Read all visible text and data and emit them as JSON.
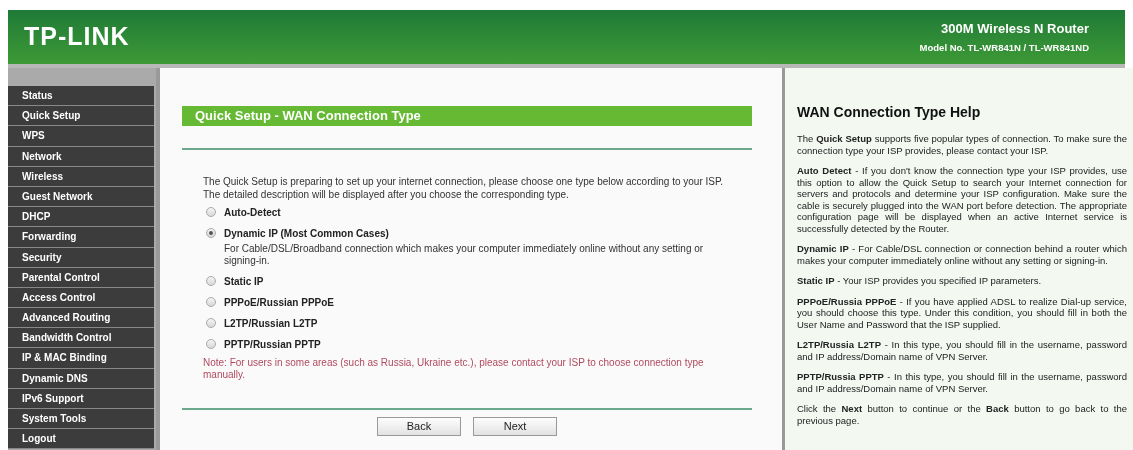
{
  "header": {
    "logo": "TP-LINK",
    "product": "300M Wireless N Router",
    "model": "Model No. TL-WR841N / TL-WR841ND"
  },
  "sidebar": {
    "items": [
      "Status",
      "Quick Setup",
      "WPS",
      "Network",
      "Wireless",
      "Guest Network",
      "DHCP",
      "Forwarding",
      "Security",
      "Parental Control",
      "Access Control",
      "Advanced Routing",
      "Bandwidth Control",
      "IP & MAC Binding",
      "Dynamic DNS",
      "IPv6 Support",
      "System Tools",
      "Logout"
    ]
  },
  "main": {
    "title": "Quick Setup - WAN Connection Type",
    "intro": [
      "The Quick Setup is preparing to set up your internet connection, please choose one type below according to your ISP.",
      "The detailed description will be displayed after you choose the corresponding type."
    ],
    "options": [
      {
        "label": "Auto-Detect",
        "selected": false
      },
      {
        "label": "Dynamic IP (Most Common Cases)",
        "selected": true,
        "description": "For Cable/DSL/Broadband connection which makes your computer immediately online without any setting or signing-in."
      },
      {
        "label": "Static IP",
        "selected": false
      },
      {
        "label": "PPPoE/Russian PPPoE",
        "selected": false
      },
      {
        "label": "L2TP/Russian L2TP",
        "selected": false
      },
      {
        "label": "PPTP/Russian PPTP",
        "selected": false
      }
    ],
    "note": "Note: For users in some areas (such as Russia, Ukraine etc.), please contact your ISP to choose connection type manually.",
    "buttons": [
      "Back",
      "Next"
    ]
  },
  "help": {
    "title": "WAN Connection Type Help",
    "paragraphs": [
      "The **Quick Setup** supports five popular types of connection. To make sure the connection type your ISP provides, please contact your ISP.",
      "**Auto Detect** - If you don't know the connection type your ISP provides, use this option to allow the Quick Setup to search your Internet connection for servers and protocols and determine your ISP configuration. Make sure the cable is securely plugged into the WAN port before detection. The appropriate configuration page will be displayed when an active Internet service is successfully detected by the Router.",
      "**Dynamic IP** - For Cable/DSL connection or connection behind a router which makes your computer immediately online without any setting or signing-in.",
      "**Static IP** - Your ISP provides you specified IP parameters.",
      "**PPPoE/Russia PPPoE** - If you have applied ADSL to realize Dial-up service, you should choose this type. Under this condition, you should fill in both the User Name and Password that the ISP supplied.",
      "**L2TP/Russia L2TP** - In this type, you should fill in the username, password and IP address/Domain name of VPN Server.",
      "**PPTP/Russia PPTP** - In this type, you should fill in the username, password and IP address/Domain name of VPN Server.",
      "Click the **Next** button to continue or the **Back** button to go back to the previous page."
    ]
  }
}
